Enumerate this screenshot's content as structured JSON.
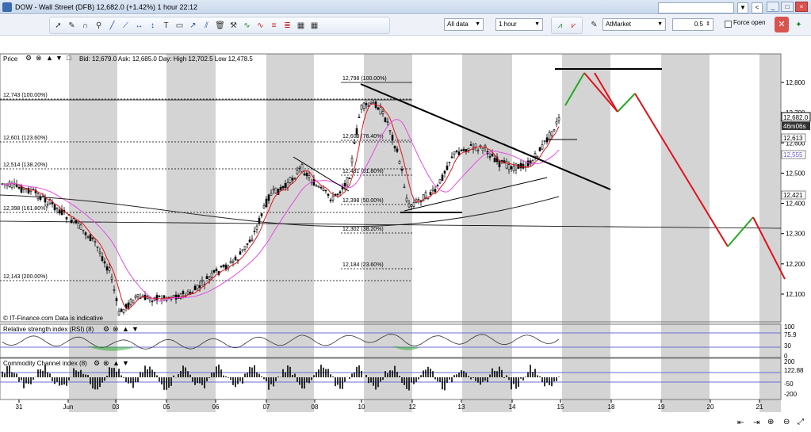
{
  "window": {
    "title": "DOW - Wall Street (DFB)    12,682.0 (+1.42%)    1 hour  22:12"
  },
  "top_right": {
    "slider_value": "<"
  },
  "toolbar": {
    "data_range": "All data",
    "interval": "1 hour",
    "order_type": "AtMarket",
    "quantity": "0.5",
    "force_open_label": "Force open"
  },
  "price_panel": {
    "label": "Price",
    "quote": "Bid: 12,679.0  Ask: 12,685.0  Day:  High 12,702.5  Low 12,478.5",
    "watermark": "© IT-Finance.com  Data is indicative"
  },
  "rsi_panel": {
    "label": "Relative strength index (RSI) (8)"
  },
  "cci_panel": {
    "label": "Commodity Channel index (8)"
  },
  "x_axis": {
    "ticks": [
      "31",
      "Jun",
      "03",
      "05",
      "06",
      "07",
      "08",
      "10",
      "12",
      "13",
      "14",
      "15",
      "18",
      "19",
      "20",
      "21"
    ]
  },
  "price_axis": {
    "ticks": [
      "12,800",
      "12,700",
      "12,600",
      "12,500",
      "12,400",
      "12,300",
      "12,200",
      "12,100"
    ],
    "current_price": "12,682.0",
    "countdown": "46m06s",
    "markers": [
      "12,613",
      "12,555",
      "12,421"
    ]
  },
  "rsi_axis": {
    "ticks": [
      "100",
      "75.9",
      "30",
      "0"
    ]
  },
  "cci_axis": {
    "ticks": [
      "200",
      "122.88",
      "-50",
      "-200"
    ]
  },
  "annotations": {
    "left_fibs": [
      "12,743 (100.00%)",
      "12,601 (123.60%)",
      "12,514 (138.20%)",
      "12,398 (161.80%)",
      "12,143 (200.00%)"
    ],
    "mid_fibs": [
      "12,798 (100.00%)",
      "12,609 (76.40%)",
      "12,491 (61.80%)",
      "12,398 (50.00%)",
      "12,302 (38.20%)",
      "12,184 (23.60%)"
    ]
  },
  "colors": {
    "accent_red": "#e0121b",
    "accent_green": "#22aa22",
    "pink_ma": "#e64be6",
    "shade": "#d4d4d4"
  },
  "icons": [
    "pointer-icon",
    "pencil-icon",
    "zoom-icon",
    "trend-line-icon",
    "close-icon",
    "settings-icon"
  ]
}
